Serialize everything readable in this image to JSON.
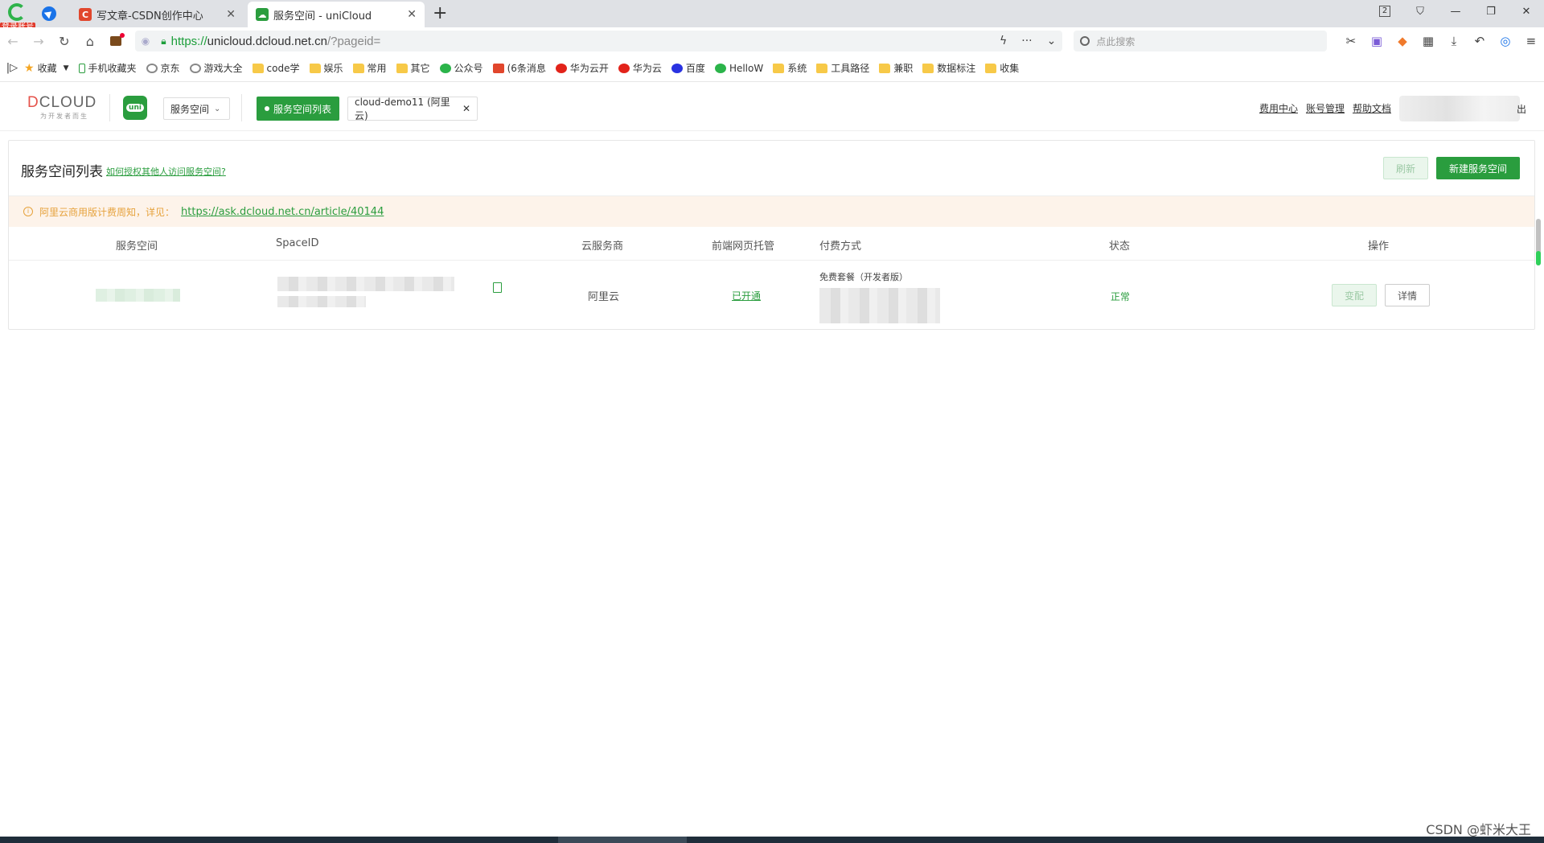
{
  "browser": {
    "login_badge": "登录账号",
    "tabs": [
      {
        "title": "写文章-CSDN创作中心",
        "favicon": "C"
      },
      {
        "title": "服务空间 - uniCloud",
        "favicon": "☁"
      }
    ],
    "tab_count": "2",
    "url": {
      "protocol": "https://",
      "host": "unicloud.dcloud.net.cn",
      "path": "/?pageid="
    },
    "search_placeholder": "点此搜索",
    "bookmarks": [
      "收藏",
      "手机收藏夹",
      "京东",
      "游戏大全",
      "code学",
      "娱乐",
      "常用",
      "其它",
      "公众号",
      "(6条消息",
      "华为云开",
      "华为云",
      "百度",
      "HelloW",
      "系统",
      "工具路径",
      "兼职",
      "数据标注",
      "收集"
    ]
  },
  "header": {
    "logo_text_red": "D",
    "logo_text_rest": "CLOUD",
    "logo_slogan": "为开发者而生",
    "uni_badge": "uni",
    "space_select": "服务空间",
    "nav_active": "服务空间列表",
    "nav_tab": "cloud-demo11 (阿里云)",
    "links": [
      "费用中心",
      "账号管理",
      "帮助文档"
    ],
    "logout": "出"
  },
  "card": {
    "title": "服务空间列表",
    "help_link": "如何授权其他人访问服务空间?",
    "refresh_button": "刷新",
    "new_button": "新建服务空间",
    "notice_text": "阿里云商用版计费周知，详见：",
    "notice_link": "https://ask.dcloud.net.cn/article/40144"
  },
  "table": {
    "headers": [
      "服务空间",
      "SpaceID",
      "云服务商",
      "前端网页托管",
      "付费方式",
      "状态",
      "操作"
    ],
    "rows": [
      {
        "provider": "阿里云",
        "hosting": "已开通",
        "plan": "免费套餐（开发者版）",
        "status": "正常",
        "actions": [
          "变配",
          "详情"
        ]
      }
    ]
  },
  "watermark": "CSDN @虾米大王",
  "colors": {
    "accent": "#2a9d3e",
    "notice_bg": "#fdf3ea",
    "notice_text": "#e6a23c"
  }
}
